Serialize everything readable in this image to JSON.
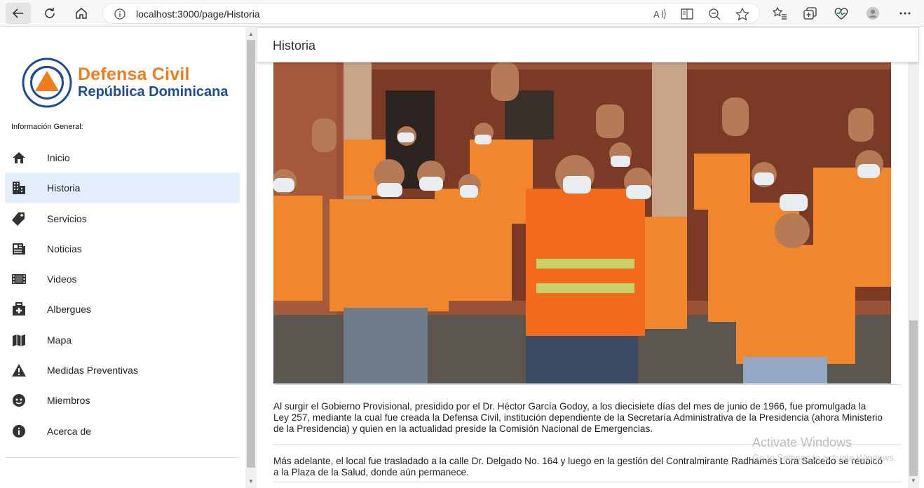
{
  "browser": {
    "url": "localhost:3000/page/Historia"
  },
  "brand": {
    "line1": "Defensa Civil",
    "line2": "República Dominicana",
    "seal_text": "DEFENSA CIVIL",
    "colors": {
      "orange": "#f07c1b",
      "blue": "#1b4c9a"
    }
  },
  "sidebar": {
    "section_label": "Información General:",
    "items": [
      {
        "label": "Inicio",
        "icon": "home-icon"
      },
      {
        "label": "Historia",
        "icon": "building-icon",
        "active": true
      },
      {
        "label": "Servicios",
        "icon": "tag-icon"
      },
      {
        "label": "Noticias",
        "icon": "newspaper-icon"
      },
      {
        "label": "Videos",
        "icon": "film-icon"
      },
      {
        "label": "Albergues",
        "icon": "medical-bag-icon"
      },
      {
        "label": "Mapa",
        "icon": "map-icon"
      },
      {
        "label": "Medidas Preventivas",
        "icon": "warning-icon"
      },
      {
        "label": "Miembros",
        "icon": "face-icon"
      },
      {
        "label": "Acerca de",
        "icon": "info-icon"
      }
    ]
  },
  "main": {
    "title": "Historia",
    "paragraphs": [
      "Al surgir el Gobierno Provisional, presidido por el Dr. Héctor García Godoy, a los diecisiete días del mes de junio de 1966, fue promulgada la Ley 257, mediante la cual fue creada la Defensa Civil, institución dependiente de la Secretaría Administrativa de la Presidencia (ahora Ministerio de la Presidencia) y quien en la actualidad preside la Comisión Nacional de Emergencias.",
      "Más adelante, el local fue trasladado a la calle Dr. Delgado No. 164 y luego en la gestión del Contralmirante Radhamés Lora Salcedo se reubicó a la Plaza de la Salud, donde aún permanece."
    ]
  },
  "watermark": {
    "line1": "Activate Windows",
    "line2": "Go to Settings to activate Windows."
  }
}
